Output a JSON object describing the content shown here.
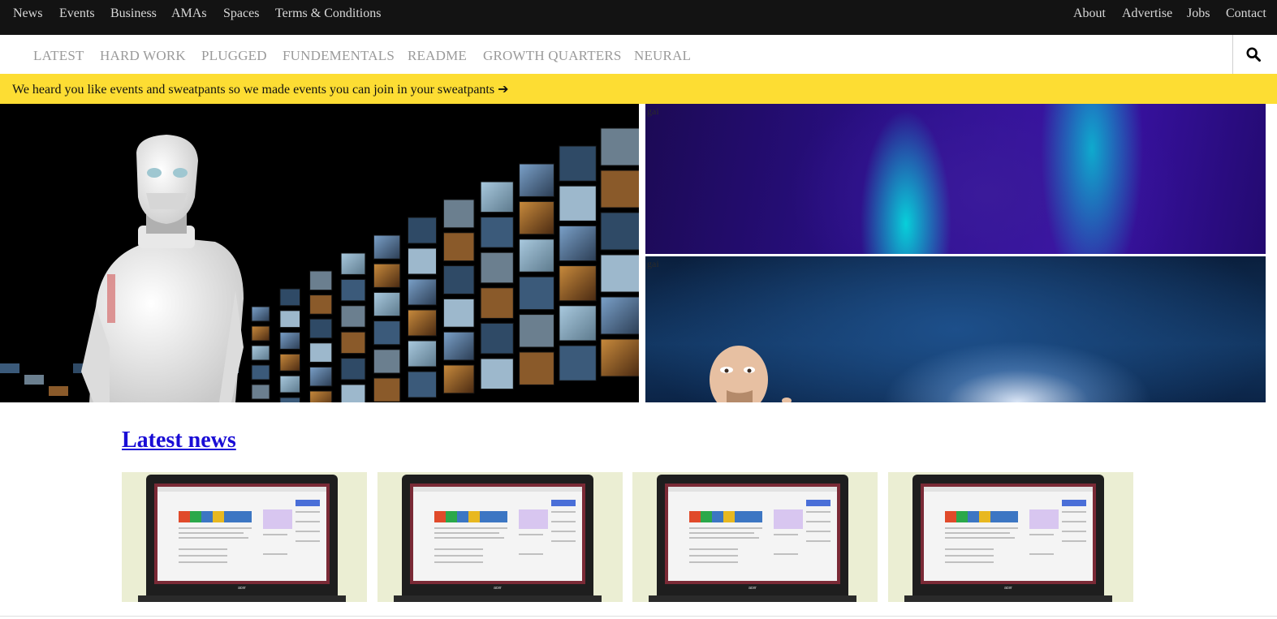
{
  "topnav": {
    "left": [
      "News",
      "Events",
      "Business",
      "AMAs",
      "Spaces",
      "Terms & Conditions"
    ],
    "right": [
      "About",
      "Advertise",
      "Jobs",
      "Contact"
    ]
  },
  "categories": [
    "LATEST",
    "HARD WORK",
    "PLUGGED",
    "FUNDEMENTALS",
    "README",
    "GROWTH QUARTERS",
    "NEURAL"
  ],
  "search": {
    "icon": "search-icon"
  },
  "banner": {
    "text": "We heard you like events and sweatpants so we made events you can join in your sweatpants ➔"
  },
  "hero": {
    "top_label": "gai",
    "bottom_label": "gai"
  },
  "latest": {
    "title": "Latest news",
    "card_count_note": "four article thumbnails"
  },
  "colors": {
    "topbar": "#131313",
    "banner": "#fddd33",
    "link": "#1a0dd6"
  }
}
